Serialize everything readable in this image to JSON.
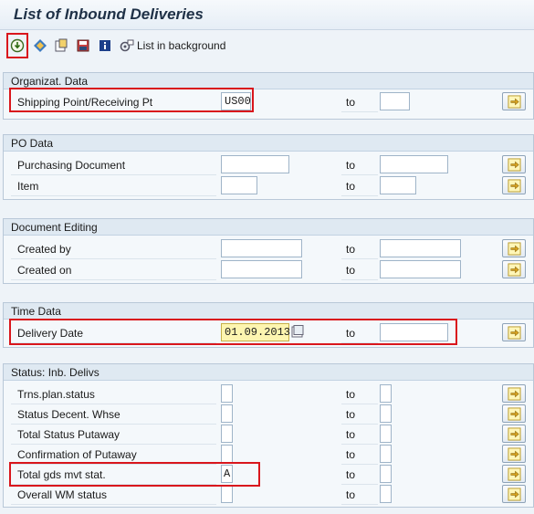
{
  "title": "List of Inbound Deliveries",
  "toolbar": {
    "execute_icon": "execute-icon",
    "background_label": "List in background"
  },
  "sections": {
    "org": {
      "header": "Organizat. Data",
      "rows": [
        {
          "label": "Shipping Point/Receiving Pt",
          "from": "US00",
          "to_label": "to",
          "to": ""
        }
      ]
    },
    "po": {
      "header": "PO Data",
      "rows": [
        {
          "label": "Purchasing Document",
          "from": "",
          "to_label": "to",
          "to": ""
        },
        {
          "label": "Item",
          "from": "",
          "to_label": "to",
          "to": ""
        }
      ]
    },
    "doc": {
      "header": "Document Editing",
      "rows": [
        {
          "label": "Created by",
          "from": "",
          "to_label": "to",
          "to": ""
        },
        {
          "label": "Created on",
          "from": "",
          "to_label": "to",
          "to": ""
        }
      ]
    },
    "time": {
      "header": "Time Data",
      "rows": [
        {
          "label": "Delivery Date",
          "from": "01.09.2013",
          "to_label": "to",
          "to": ""
        }
      ]
    },
    "status": {
      "header": "Status: Inb. Delivs",
      "rows": [
        {
          "label": "Trns.plan.status",
          "from": "",
          "to_label": "to",
          "to": ""
        },
        {
          "label": "Status Decent. Whse",
          "from": "",
          "to_label": "to",
          "to": ""
        },
        {
          "label": "Total Status Putaway",
          "from": "",
          "to_label": "to",
          "to": ""
        },
        {
          "label": "Confirmation of Putaway",
          "from": "",
          "to_label": "to",
          "to": ""
        },
        {
          "label": "Total gds mvt stat.",
          "from": "A",
          "to_label": "to",
          "to": ""
        },
        {
          "label": "Overall WM status",
          "from": "",
          "to_label": "to",
          "to": ""
        }
      ]
    }
  },
  "colors": {
    "highlight": "#d9161c",
    "required_field": "#fdf5b0"
  }
}
